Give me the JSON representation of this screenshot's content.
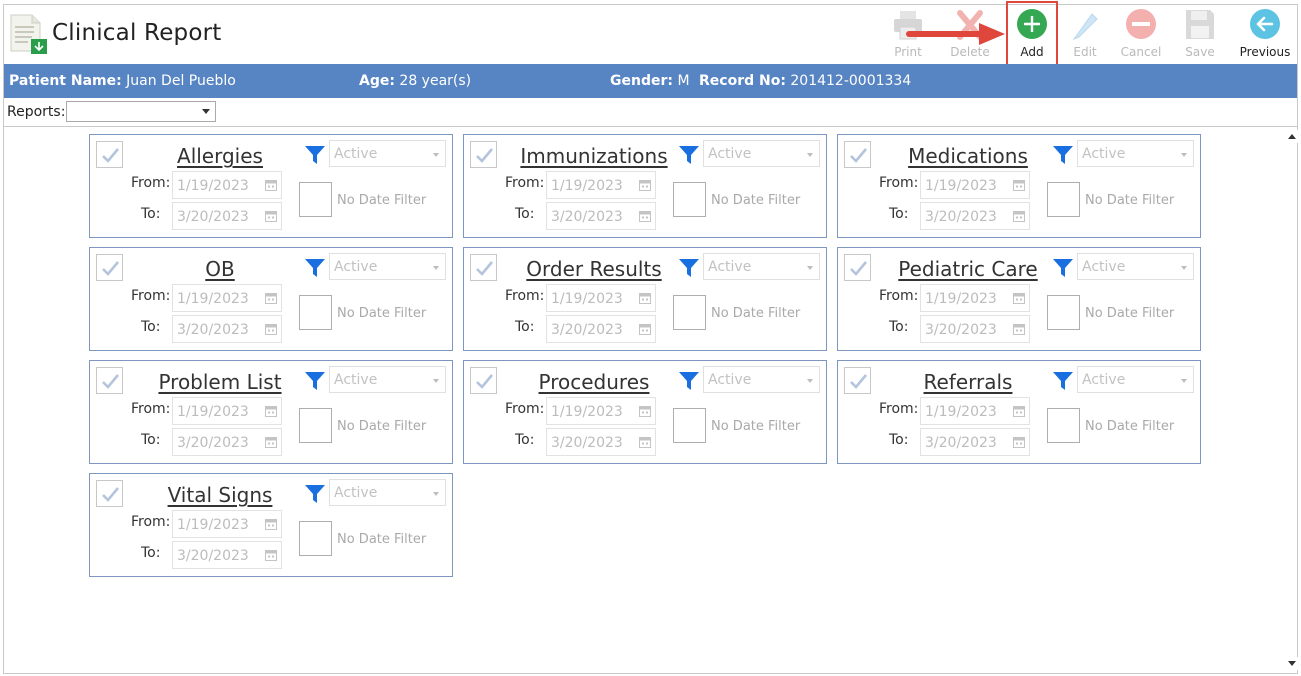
{
  "header": {
    "title": "Clinical Report"
  },
  "toolbar": {
    "print_label": "Print",
    "delete_label": "Delete",
    "add_label": "Add",
    "edit_label": "Edit",
    "cancel_label": "Cancel",
    "save_label": "Save",
    "previous_label": "Previous"
  },
  "patient": {
    "name_label": "Patient Name:",
    "name": "Juan Del Pueblo",
    "age_label": "Age:",
    "age": "28 year(s)",
    "gender_label": "Gender:",
    "gender": "M",
    "record_label": "Record No:",
    "record": "201412-0001334"
  },
  "reports": {
    "label": "Reports:",
    "value": ""
  },
  "common": {
    "from_label": "From:",
    "to_label": "To:",
    "status": "Active",
    "no_date_filter": "No Date Filter",
    "from_date": "1/19/2023",
    "to_date": "3/20/2023"
  },
  "categories": [
    {
      "title": "Allergies"
    },
    {
      "title": "Immunizations"
    },
    {
      "title": "Medications"
    },
    {
      "title": "OB"
    },
    {
      "title": "Order Results"
    },
    {
      "title": "Pediatric Care"
    },
    {
      "title": "Problem List"
    },
    {
      "title": "Procedures"
    },
    {
      "title": "Referrals"
    },
    {
      "title": "Vital Signs"
    }
  ],
  "colors": {
    "banner": "#5784c3",
    "card_border": "#7d97c0",
    "add_green": "#34a853",
    "highlight_red": "#e0473c",
    "filter_blue": "#1a6fe0"
  }
}
